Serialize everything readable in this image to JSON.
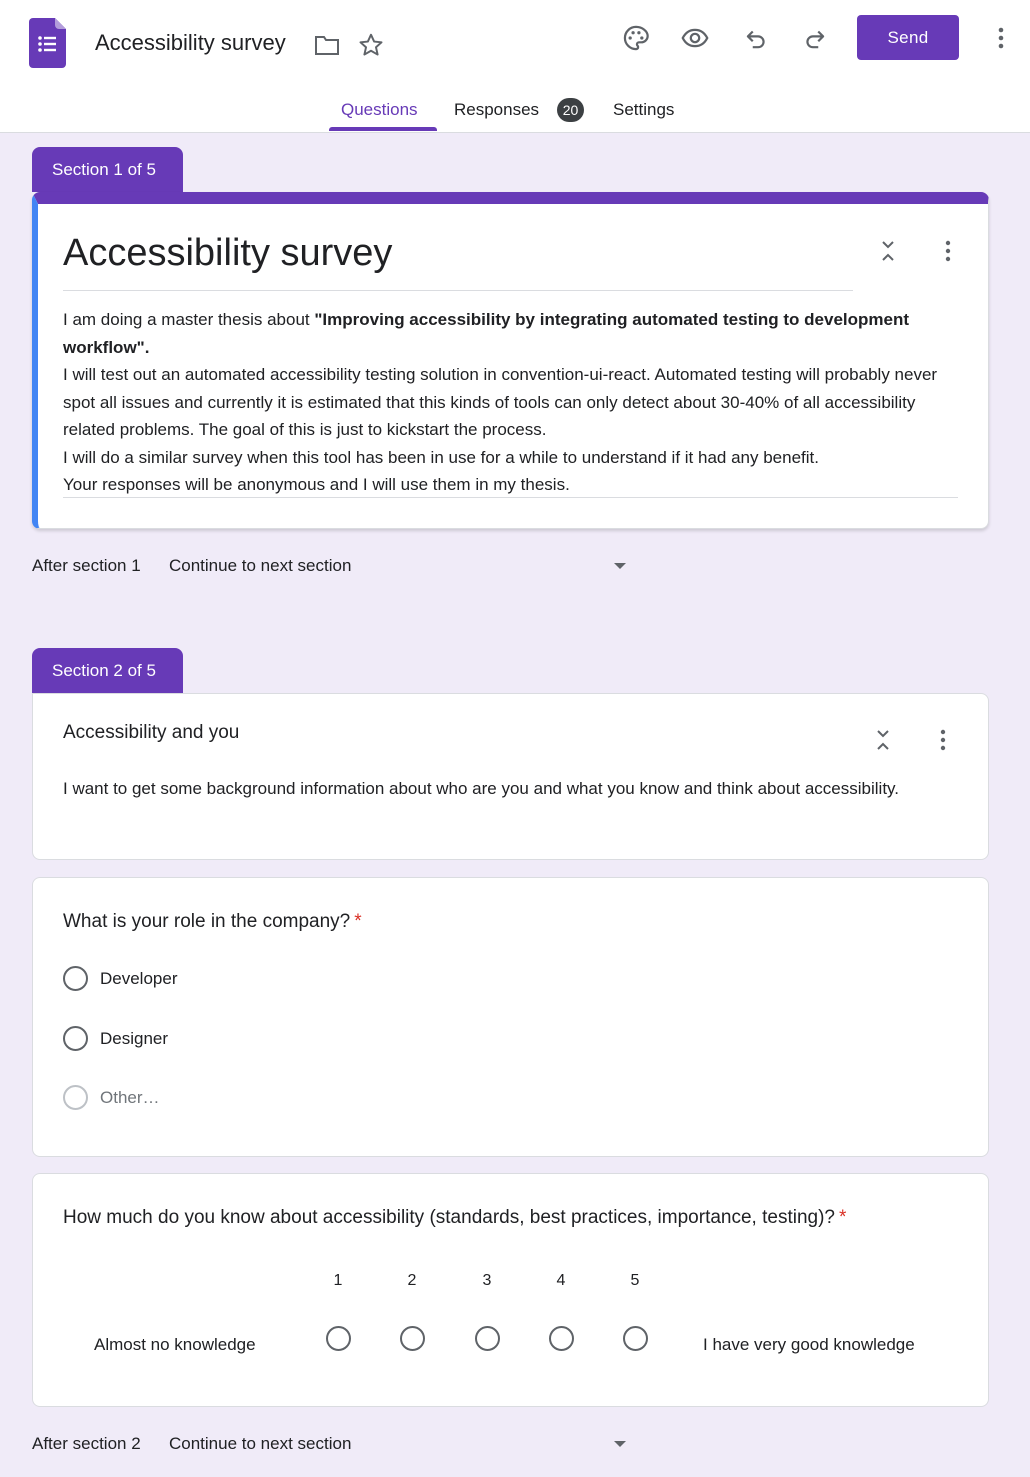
{
  "header": {
    "title": "Accessibility survey",
    "send_label": "Send",
    "icons": [
      "forms-logo-icon",
      "folder-icon",
      "star-icon",
      "palette-icon",
      "eye-icon",
      "undo-icon",
      "redo-icon",
      "more-vert-icon"
    ],
    "accent": "#673ab7"
  },
  "tabs": {
    "questions": "Questions",
    "responses": "Responses",
    "responses_count": "20",
    "settings": "Settings"
  },
  "section1": {
    "tab": "Section 1 of 5",
    "title": "Accessibility survey",
    "desc_intro": "I am doing a master thesis about ",
    "desc_bold": "\"Improving accessibility by integrating automated testing to development workflow\".",
    "desc_p2": "I will test out an automated accessibility testing solution in convention-ui-react. Automated testing will probably never spot all issues and currently it is estimated that this kinds of tools can only detect about 30-40% of all accessibility related problems. The goal of this is just to kickstart the process.",
    "desc_p3": "I will do a similar survey when this tool has been in use for a while to understand if it had any benefit.",
    "desc_p4": "Your responses will be anonymous and I will use them in my thesis.",
    "after_label": "After section 1",
    "after_value": "Continue to next section"
  },
  "section2": {
    "tab": "Section 2 of 5",
    "title": "Accessibility and you",
    "desc": "I want to get some background information about who are you and what you know and think about accessibility.",
    "after_label": "After section 2",
    "after_value": "Continue to next section"
  },
  "question_role": {
    "title": "What is your role in the company?",
    "required": "*",
    "options": [
      "Developer",
      "Designer",
      "Other…"
    ]
  },
  "question_knowledge": {
    "title": "How much do you know about accessibility (standards, best practices, importance, testing)?",
    "required": "*",
    "scale": [
      "1",
      "2",
      "3",
      "4",
      "5"
    ],
    "low_label": "Almost no knowledge",
    "high_label": "I have very good knowledge"
  }
}
